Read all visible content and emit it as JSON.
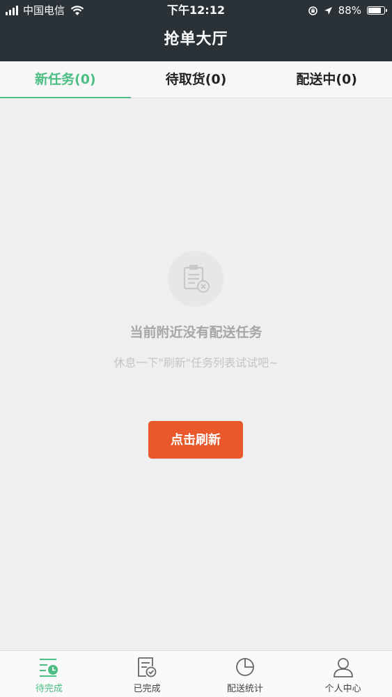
{
  "status_bar": {
    "carrier": "中国电信",
    "time": "下午12:12",
    "battery_text": "88%",
    "battery_level": 0.88
  },
  "header": {
    "title": "抢单大厅"
  },
  "tabs": [
    {
      "label": "新任务(0)",
      "active": true
    },
    {
      "label": "待取货(0)",
      "active": false
    },
    {
      "label": "配送中(0)",
      "active": false
    }
  ],
  "empty_state": {
    "icon": "clipboard-x-icon",
    "title": "当前附近没有配送任务",
    "subtitle": "休息一下\"刷新\"任务列表试试吧~",
    "refresh_label": "点击刷新"
  },
  "bottom_nav": [
    {
      "label": "待完成",
      "icon": "pending-list-icon",
      "active": true
    },
    {
      "label": "已完成",
      "icon": "completed-doc-icon",
      "active": false
    },
    {
      "label": "配送统计",
      "icon": "pie-chart-icon",
      "active": false
    },
    {
      "label": "个人中心",
      "icon": "user-icon",
      "active": false
    }
  ],
  "colors": {
    "header_bg": "#2a3137",
    "accent_green": "#4cbe83",
    "button_orange": "#e9582a",
    "page_bg": "#efefef"
  }
}
